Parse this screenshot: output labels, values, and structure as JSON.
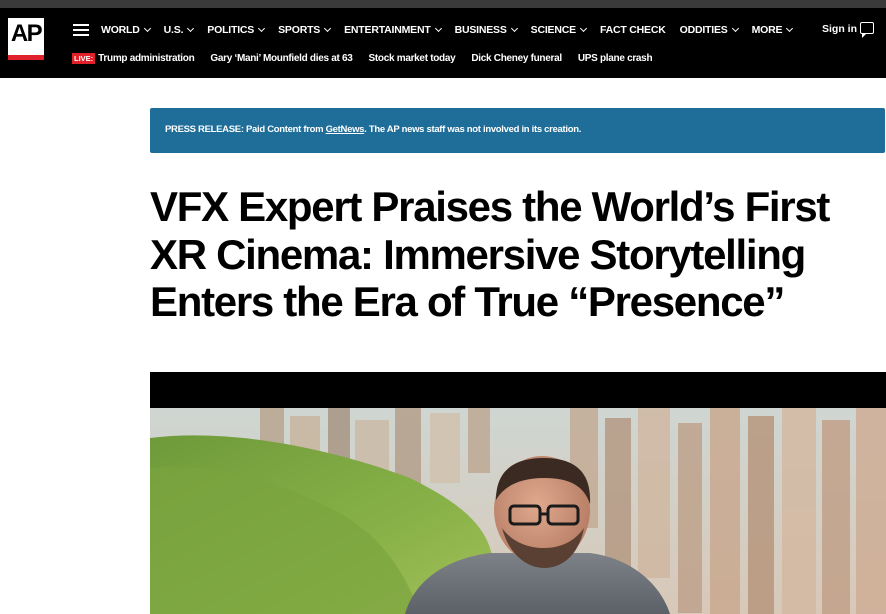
{
  "header": {
    "logo_text": "AP",
    "nav": [
      {
        "label": "WORLD",
        "dropdown": true
      },
      {
        "label": "U.S.",
        "dropdown": true
      },
      {
        "label": "POLITICS",
        "dropdown": true
      },
      {
        "label": "SPORTS",
        "dropdown": true
      },
      {
        "label": "ENTERTAINMENT",
        "dropdown": true
      },
      {
        "label": "BUSINESS",
        "dropdown": true
      },
      {
        "label": "SCIENCE",
        "dropdown": true
      },
      {
        "label": "FACT CHECK",
        "dropdown": false
      },
      {
        "label": "ODDITIES",
        "dropdown": true
      },
      {
        "label": "MORE",
        "dropdown": true
      }
    ],
    "signin_label": "Sign in",
    "live_label": "LIVE:",
    "trending": [
      "Trump administration",
      "Gary ‘Mani’ Mounfield dies at 63",
      "Stock market today",
      "Dick Cheney funeral",
      "UPS plane crash"
    ]
  },
  "press_release": {
    "prefix": "PRESS RELEASE: Paid Content from ",
    "link": "GetNews",
    "suffix": ". The AP news staff was not involved in its creation."
  },
  "article": {
    "headline": "VFX Expert Praises the World’s First XR Cinema: Immersive Storytelling Enters the Era of True “Presence”"
  },
  "colors": {
    "header_bg": "#000000",
    "accent_red": "#e0202a",
    "press_bg": "#1f6e9a"
  }
}
